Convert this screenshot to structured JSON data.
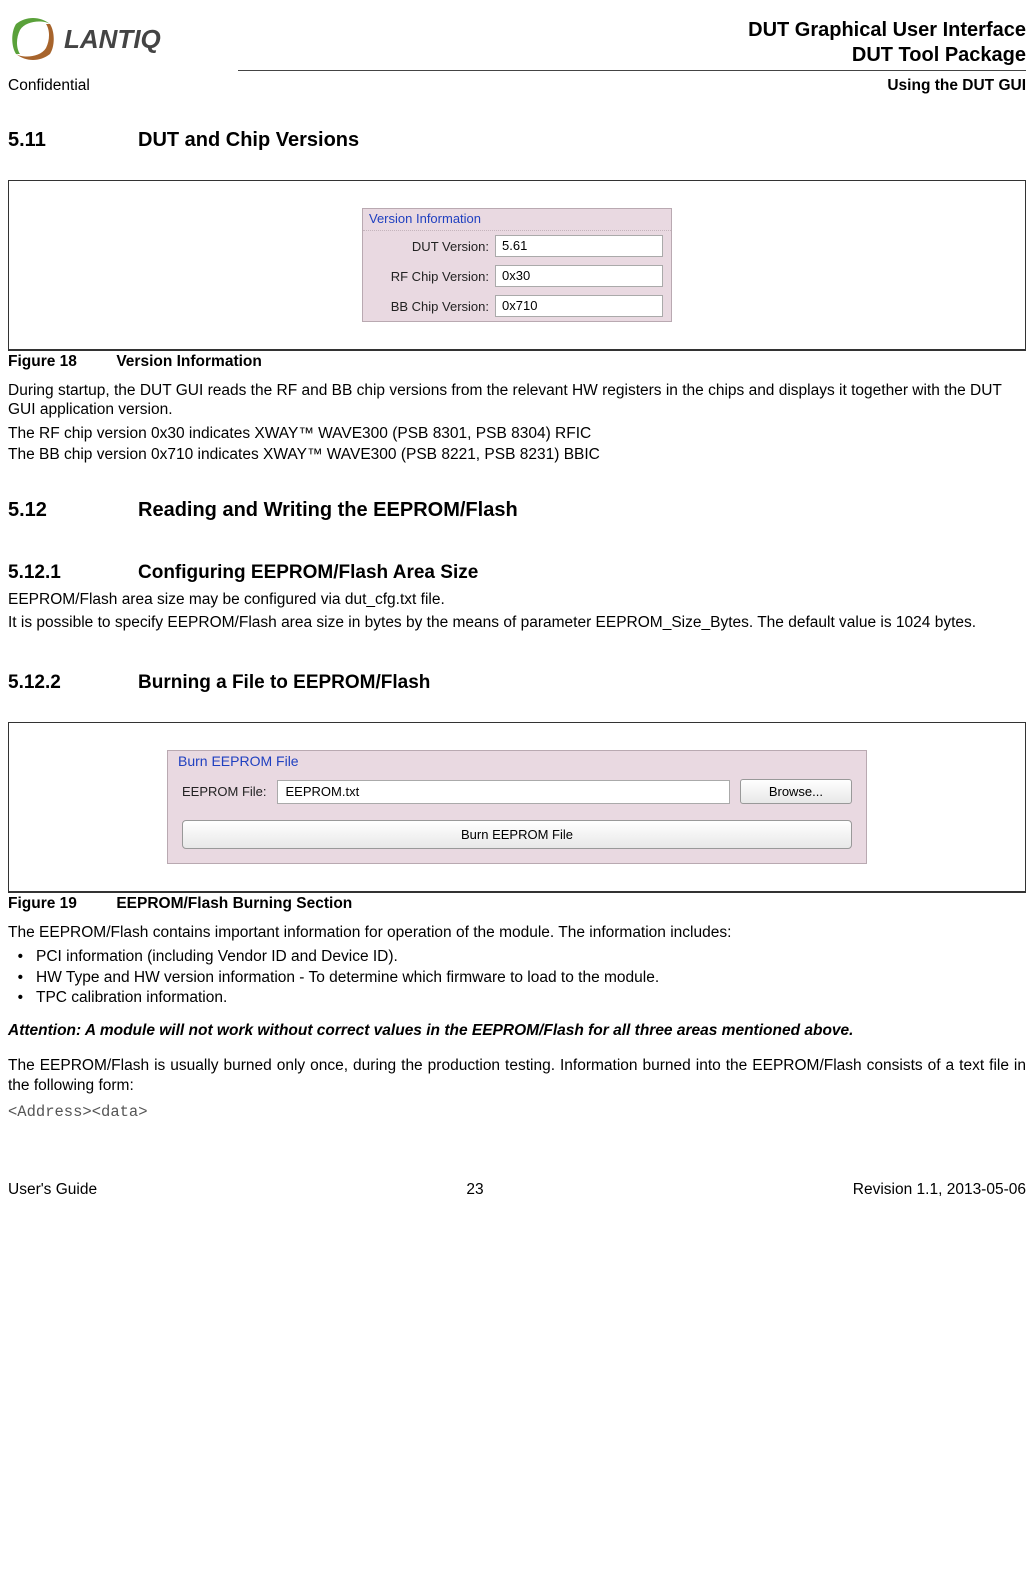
{
  "header": {
    "logo_text": "LANTIQ",
    "title_line1": "DUT Graphical User Interface",
    "title_line2": "DUT Tool Package",
    "confidential": "Confidential",
    "section_title": "Using the DUT GUI"
  },
  "section_5_11": {
    "num": "5.11",
    "title": "DUT and Chip Versions"
  },
  "figure18": {
    "legend": "Version Information",
    "rows": [
      {
        "label": "DUT Version:",
        "value": "5.61"
      },
      {
        "label": "RF Chip Version:",
        "value": "0x30"
      },
      {
        "label": "BB Chip Version:",
        "value": "0x710"
      }
    ],
    "caption_num": "Figure 18",
    "caption_text": "Version Information"
  },
  "para_5_11": {
    "p1": "During startup, the DUT GUI reads the RF and BB chip versions from the relevant HW registers in the chips and displays it together with the DUT GUI application version.",
    "p2": "The RF chip version 0x30 indicates XWAY™ WAVE300 (PSB 8301, PSB 8304) RFIC",
    "p3": "The BB chip version 0x710 indicates XWAY™ WAVE300 (PSB 8221, PSB 8231) BBIC"
  },
  "section_5_12": {
    "num": "5.12",
    "title": "Reading and Writing the EEPROM/Flash"
  },
  "section_5_12_1": {
    "num": "5.12.1",
    "title": "Configuring EEPROM/Flash Area Size",
    "p1": "EEPROM/Flash area size may be configured via dut_cfg.txt file.",
    "p2": "It is possible to specify EEPROM/Flash area size in bytes by the means of parameter EEPROM_Size_Bytes. The default value is 1024 bytes."
  },
  "section_5_12_2": {
    "num": "5.12.2",
    "title": "Burning a File to EEPROM/Flash"
  },
  "figure19": {
    "legend": "Burn EEPROM File",
    "file_label": "EEPROM File:",
    "file_value": "EEPROM.txt",
    "browse_btn": "Browse...",
    "burn_btn": "Burn EEPROM File",
    "caption_num": "Figure 19",
    "caption_text": "EEPROM/Flash Burning Section"
  },
  "para_5_12_2": {
    "p1": "The EEPROM/Flash contains important information for operation of the module. The information includes:",
    "bullets": [
      "PCI information (including Vendor ID and Device ID).",
      "HW Type and HW version information - To determine which firmware to load to the module.",
      "TPC calibration information."
    ],
    "attention": "Attention: A module will not work without correct values in the EEPROM/Flash for all three areas mentioned above.",
    "p2": "The EEPROM/Flash is usually burned only once, during the production testing. Information burned into the EEPROM/Flash consists of a text file in the following form:",
    "code": "<Address><data>"
  },
  "footer": {
    "left": "User's Guide",
    "center": "23",
    "right": "Revision 1.1, 2013-05-06"
  }
}
